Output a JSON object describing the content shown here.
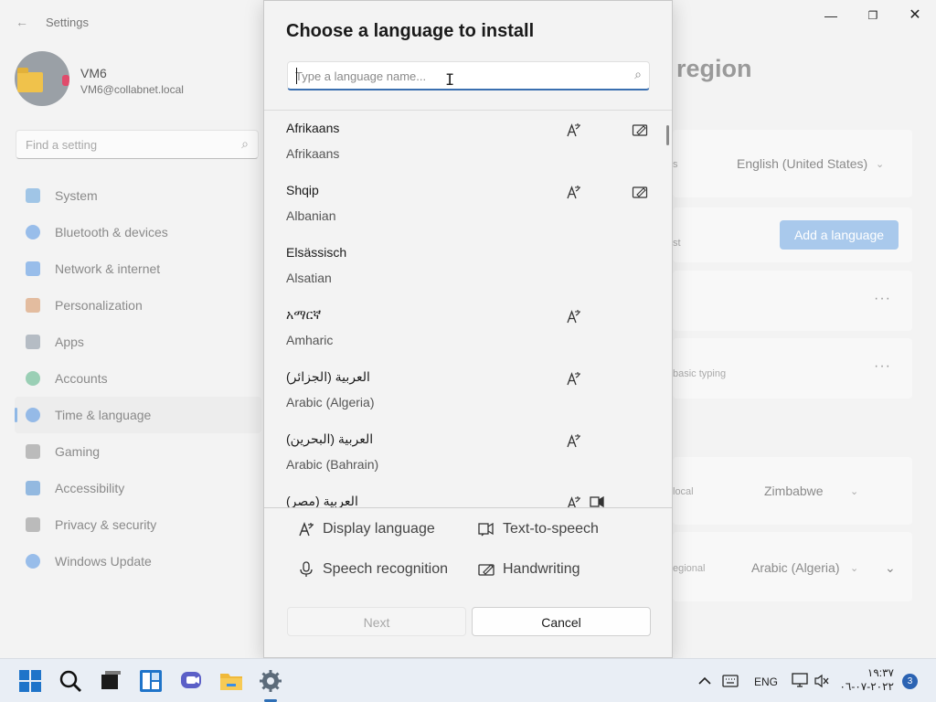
{
  "settings": {
    "app_title": "Settings",
    "profile": {
      "name": "VM6",
      "email": "VM6@collabnet.local"
    },
    "find_placeholder": "Find a setting",
    "nav": [
      {
        "label": "System",
        "icon": "monitor-icon",
        "color": "#3b8fd6"
      },
      {
        "label": "Bluetooth & devices",
        "icon": "bluetooth-icon",
        "color": "#2a7de1"
      },
      {
        "label": "Network & internet",
        "icon": "wifi-icon",
        "color": "#2a7de1"
      },
      {
        "label": "Personalization",
        "icon": "brush-icon",
        "color": "#d07a3a"
      },
      {
        "label": "Apps",
        "icon": "apps-icon",
        "color": "#6b7a8c"
      },
      {
        "label": "Accounts",
        "icon": "person-icon",
        "color": "#2fa36b"
      },
      {
        "label": "Time & language",
        "icon": "globe-clock-icon",
        "color": "#2a7de1"
      },
      {
        "label": "Gaming",
        "icon": "gamepad-icon",
        "color": "#777"
      },
      {
        "label": "Accessibility",
        "icon": "accessibility-icon",
        "color": "#1f74c9"
      },
      {
        "label": "Privacy & security",
        "icon": "shield-icon",
        "color": "#777"
      },
      {
        "label": "Windows Update",
        "icon": "update-icon",
        "color": "#2a7de1"
      }
    ],
    "active_nav": "Time & language",
    "page_title_fragment": "region",
    "windows_display_language_value": "English (United States)",
    "add_language_label": "Add a language",
    "country_value": "Zimbabwe",
    "regional_format_value": "Arabic (Algeria)",
    "partial_texts": {
      "card1": "s",
      "card2": "st",
      "card4": "basic typing",
      "card5": "local",
      "card6": "egional"
    }
  },
  "dialog": {
    "title": "Choose a language to install",
    "search_placeholder": "Type a language name...",
    "languages": [
      {
        "native": "Afrikaans",
        "english": "Afrikaans",
        "display": true,
        "handwriting": true,
        "tts": false
      },
      {
        "native": "Shqip",
        "english": "Albanian",
        "display": true,
        "handwriting": true,
        "tts": false
      },
      {
        "native": "Elsässisch",
        "english": "Alsatian",
        "display": false,
        "handwriting": false,
        "tts": false
      },
      {
        "native": "አማርኛ",
        "english": "Amharic",
        "display": true,
        "handwriting": false,
        "tts": false
      },
      {
        "native": "العربية (الجزائر)",
        "english": "Arabic (Algeria)",
        "display": true,
        "handwriting": false,
        "tts": false
      },
      {
        "native": "العربية (البحرين)",
        "english": "Arabic (Bahrain)",
        "display": true,
        "handwriting": false,
        "tts": false
      },
      {
        "native": "العربية (مصر)",
        "english": "",
        "display": true,
        "handwriting": false,
        "tts": true
      }
    ],
    "legend": {
      "display": "Display language",
      "tts": "Text-to-speech",
      "speech": "Speech recognition",
      "handwriting": "Handwriting"
    },
    "next_label": "Next",
    "cancel_label": "Cancel"
  },
  "taskbar": {
    "apps": [
      "start-icon",
      "search-icon",
      "task-view-icon",
      "widgets-icon",
      "teams-chat-icon",
      "file-explorer-icon",
      "settings-icon"
    ],
    "lang_indicator": "ENG",
    "time": "١٩:٣٧",
    "date": "٢٠٢٢-٠٧-٠٦",
    "notification_count": "3",
    "accent": "#2e6fb6"
  }
}
